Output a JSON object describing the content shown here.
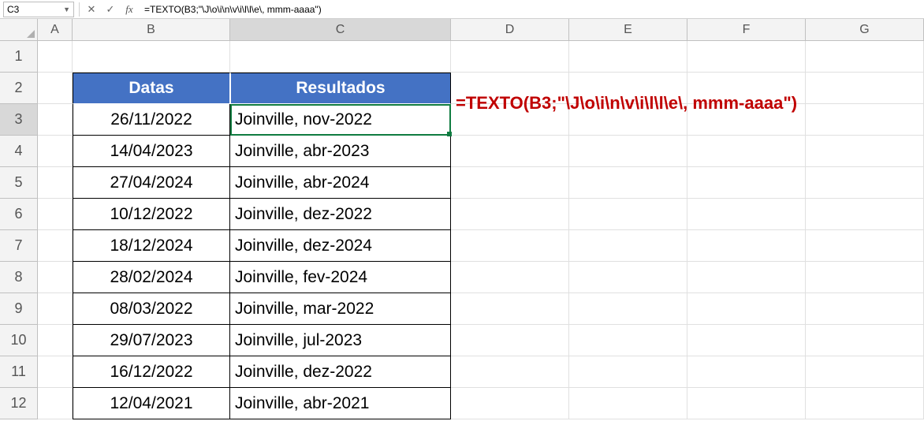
{
  "namebox": "C3",
  "formula_bar": "=TEXTO(B3;\"\\J\\o\\i\\n\\v\\i\\l\\l\\e\\, mmm-aaaa\")",
  "overlay_formula": "=TEXTO(B3;\"\\J\\o\\i\\n\\v\\i\\l\\l\\e\\, mmm-aaaa\")",
  "columns": [
    "A",
    "B",
    "C",
    "D",
    "E",
    "F",
    "G"
  ],
  "rows": [
    "1",
    "2",
    "3",
    "4",
    "5",
    "6",
    "7",
    "8",
    "9",
    "10",
    "11",
    "12"
  ],
  "headers": {
    "b": "Datas",
    "c": "Resultados"
  },
  "data": [
    {
      "b": "26/11/2022",
      "c": "Joinville, nov-2022"
    },
    {
      "b": "14/04/2023",
      "c": "Joinville, abr-2023"
    },
    {
      "b": "27/04/2024",
      "c": "Joinville, abr-2024"
    },
    {
      "b": "10/12/2022",
      "c": "Joinville, dez-2022"
    },
    {
      "b": "18/12/2024",
      "c": "Joinville, dez-2024"
    },
    {
      "b": "28/02/2024",
      "c": "Joinville, fev-2024"
    },
    {
      "b": "08/03/2022",
      "c": "Joinville, mar-2022"
    },
    {
      "b": "29/07/2023",
      "c": "Joinville, jul-2023"
    },
    {
      "b": "16/12/2022",
      "c": "Joinville, dez-2022"
    },
    {
      "b": "12/04/2021",
      "c": "Joinville, abr-2021"
    }
  ]
}
